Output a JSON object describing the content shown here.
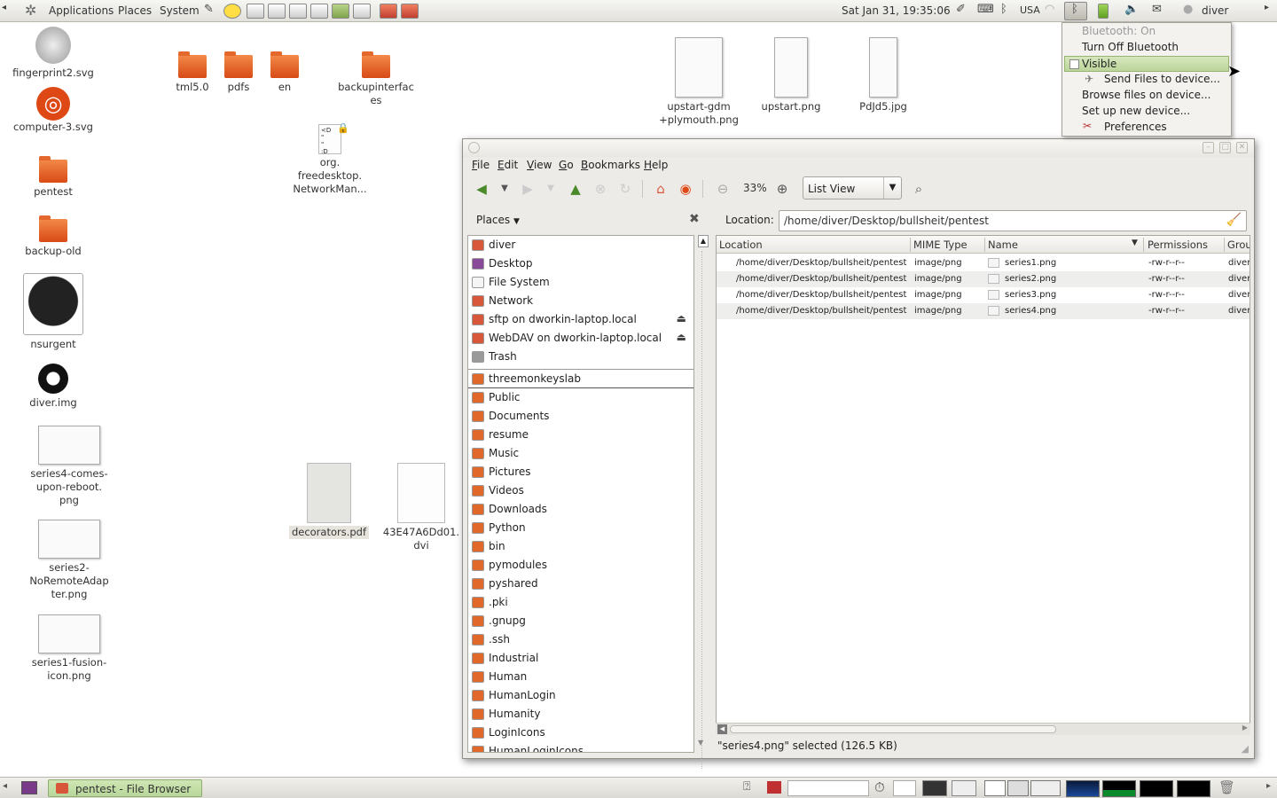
{
  "top_panel": {
    "menus": [
      "Applications",
      "Places",
      "System"
    ],
    "clock": "Sat Jan 31, 19:35:06",
    "keyboard_layout": "USA",
    "user": "diver"
  },
  "desktop": {
    "icons_left": [
      {
        "label": "fingerprint2.svg"
      },
      {
        "label": "computer-3.svg"
      },
      {
        "label": "pentest"
      },
      {
        "label": "backup-old"
      },
      {
        "label": "nsurgent"
      },
      {
        "label": "diver.img"
      },
      {
        "label": "series4-comes-\nupon-reboot.\npng"
      },
      {
        "label": "series2-\nNoRemoteAdap\nter.png"
      },
      {
        "label": "series1-fusion-\nicon.png"
      }
    ],
    "folders_top": [
      {
        "label": "tml5.0"
      },
      {
        "label": "pdfs"
      },
      {
        "label": "en"
      },
      {
        "label": "backupinterfac\nes"
      }
    ],
    "lock_file": {
      "label": "org.\nfreedesktop.\nNetworkMan...",
      "glyph": "<D\n\"\n\"\n:D"
    },
    "images_top": [
      {
        "label": "upstart-gdm\n+plymouth.png"
      },
      {
        "label": "upstart.png"
      },
      {
        "label": "PdJd5.jpg"
      }
    ],
    "docs": [
      {
        "label": "decorators.pdf"
      },
      {
        "label": "43E47A6Dd01.\ndvi"
      }
    ]
  },
  "bluetooth_menu": {
    "status": "Bluetooth: On",
    "toggle": "Turn Off Bluetooth",
    "visible": "Visible",
    "send_files": "Send Files to device...",
    "browse_files": "Browse files on device...",
    "setup": "Set up new device...",
    "preferences": "Preferences"
  },
  "file_browser": {
    "menus": [
      {
        "label": "File",
        "mnemonic": "F",
        "rest": "ile"
      },
      {
        "label": "Edit",
        "mnemonic": "E",
        "rest": "dit"
      },
      {
        "label": "View",
        "mnemonic": "V",
        "rest": "iew"
      },
      {
        "label": "Go",
        "mnemonic": "G",
        "rest": "o"
      },
      {
        "label": "Bookmarks",
        "mnemonic": "B",
        "rest": "ookmarks"
      },
      {
        "label": "Help",
        "mnemonic": "H",
        "rest": "elp"
      }
    ],
    "zoom": "33%",
    "view_mode": "List View",
    "places_label": "Places",
    "location_label": "Location:",
    "location_value": "/home/diver/Desktop/bullsheit/pentest",
    "places": [
      {
        "label": "diver",
        "color": "#d8573a"
      },
      {
        "label": "Desktop",
        "color": "#8a4a9a"
      },
      {
        "label": "File System",
        "color": "#f4f4f4"
      },
      {
        "label": "Network",
        "color": "#d8573a"
      },
      {
        "label": "sftp on dworkin-laptop.local",
        "color": "#d8573a",
        "eject": true
      },
      {
        "label": "WebDAV on dworkin-laptop.local",
        "color": "#d8573a",
        "eject": true
      },
      {
        "label": "Trash",
        "color": "#9a9a9a"
      }
    ],
    "bookmarks": [
      {
        "label": "threemonkeyslab"
      },
      {
        "label": "Public"
      },
      {
        "label": "Documents"
      },
      {
        "label": "resume"
      },
      {
        "label": "Music"
      },
      {
        "label": "Pictures"
      },
      {
        "label": "Videos"
      },
      {
        "label": "Downloads"
      },
      {
        "label": "Python"
      },
      {
        "label": "bin"
      },
      {
        "label": "pymodules"
      },
      {
        "label": "pyshared"
      },
      {
        "label": ".pki"
      },
      {
        "label": ".gnupg"
      },
      {
        "label": ".ssh"
      },
      {
        "label": "Industrial"
      },
      {
        "label": "Human"
      },
      {
        "label": "HumanLogin"
      },
      {
        "label": "Humanity"
      },
      {
        "label": "LoginIcons"
      },
      {
        "label": "HumanLoginIcons"
      }
    ],
    "columns": [
      "Location",
      "MIME Type",
      "Name",
      "Permissions",
      "Grou"
    ],
    "files": [
      {
        "location": "/home/diver/Desktop/bullsheit/pentest",
        "mime": "image/png",
        "name": "series1.png",
        "perms": "-rw-r--r--",
        "group": "diver"
      },
      {
        "location": "/home/diver/Desktop/bullsheit/pentest",
        "mime": "image/png",
        "name": "series2.png",
        "perms": "-rw-r--r--",
        "group": "diver"
      },
      {
        "location": "/home/diver/Desktop/bullsheit/pentest",
        "mime": "image/png",
        "name": "series3.png",
        "perms": "-rw-r--r--",
        "group": "diver"
      },
      {
        "location": "/home/diver/Desktop/bullsheit/pentest",
        "mime": "image/png",
        "name": "series4.png",
        "perms": "-rw-r--r--",
        "group": "diver"
      }
    ],
    "status": "\"series4.png\" selected (126.5 KB)"
  },
  "bottom_panel": {
    "task": "pentest - File Browser"
  }
}
